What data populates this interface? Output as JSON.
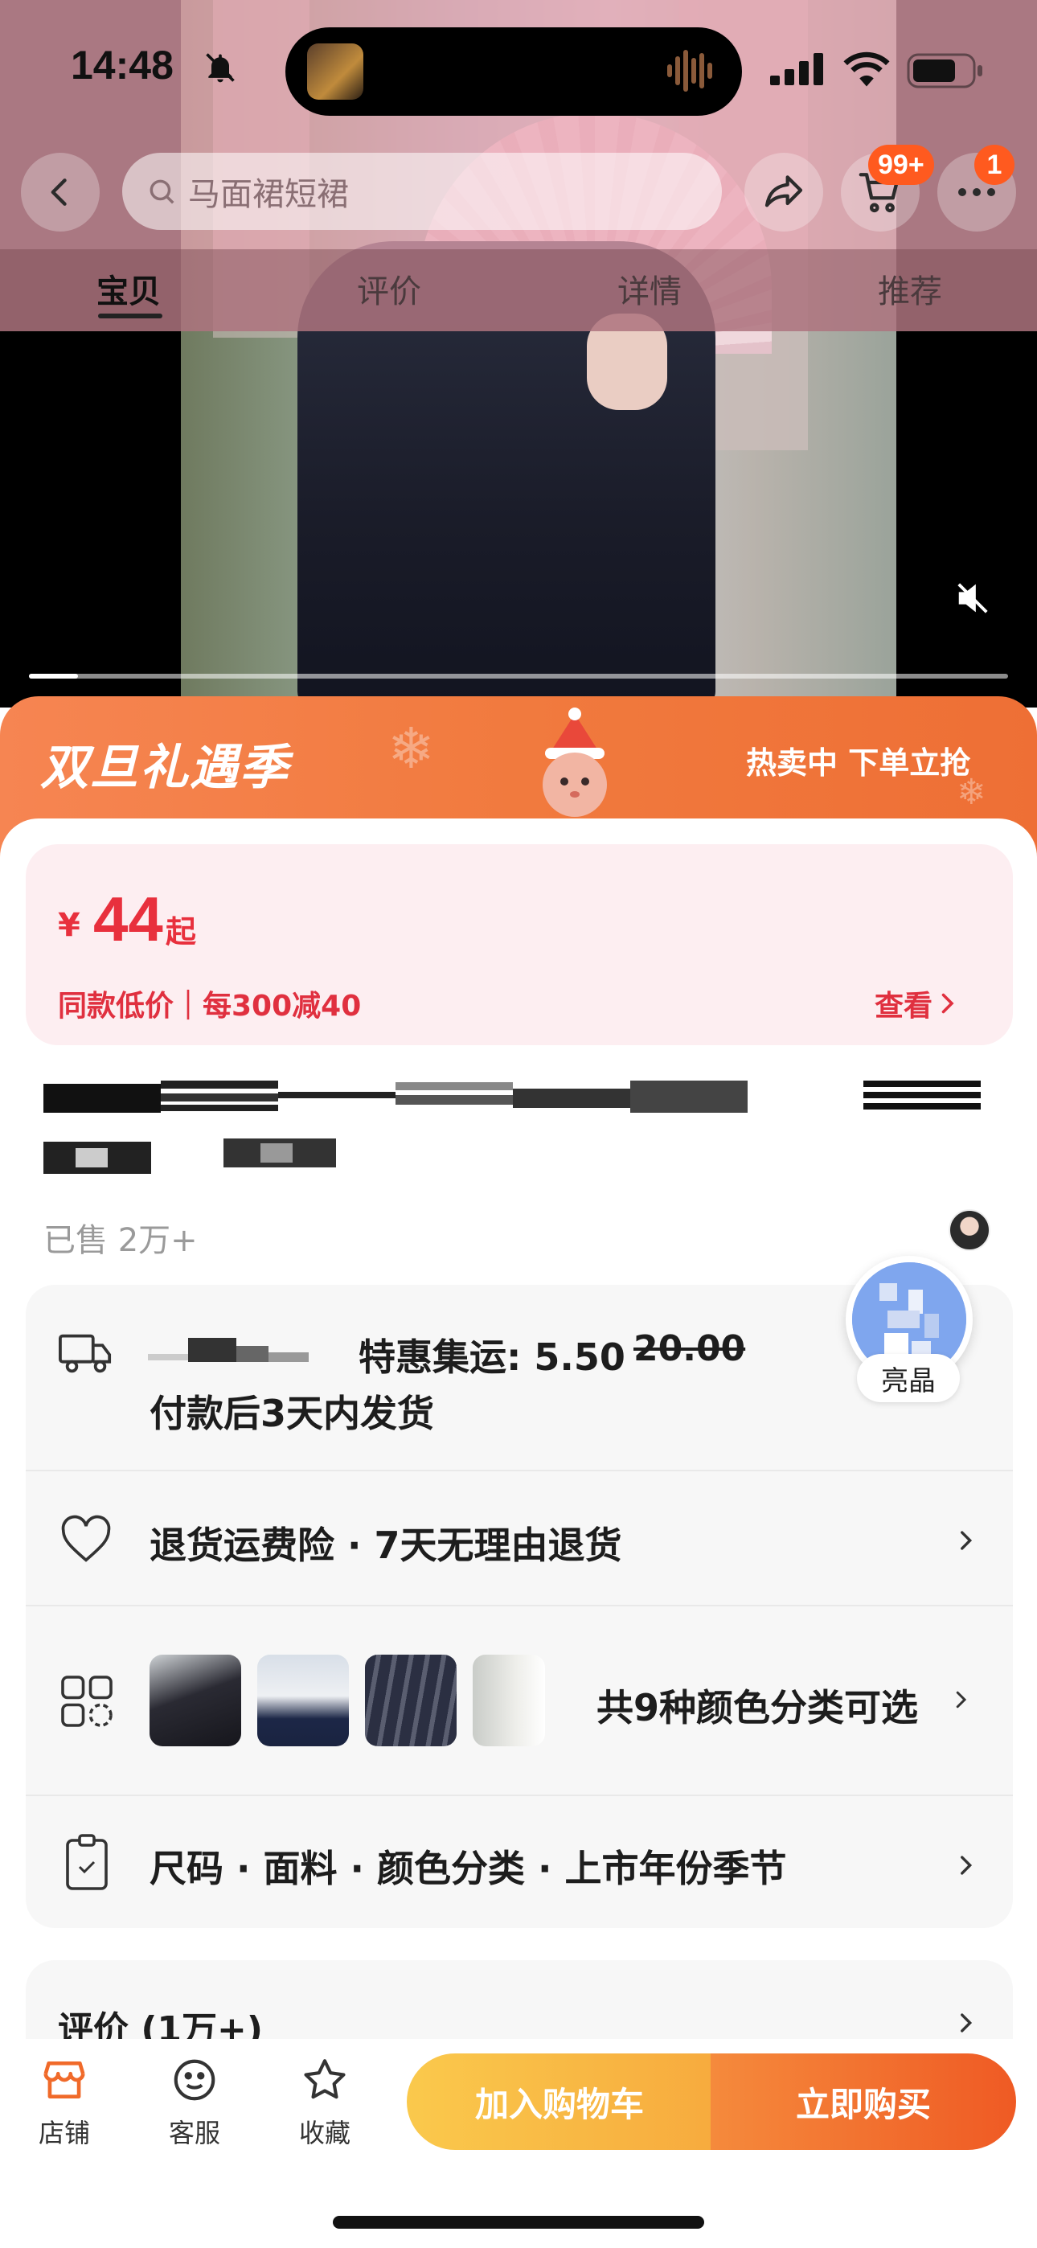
{
  "status_bar": {
    "time": "14:48"
  },
  "search": {
    "placeholder": "马面裙短裙"
  },
  "header": {
    "cart_badge": "99+",
    "more_badge": "1"
  },
  "tabs": [
    {
      "label": "宝贝",
      "active": true
    },
    {
      "label": "评价",
      "active": false
    },
    {
      "label": "详情",
      "active": false
    },
    {
      "label": "推荐",
      "active": false
    }
  ],
  "video": {
    "progress": 0.05,
    "muted": true
  },
  "promo": {
    "title": "双旦礼遇季",
    "right": "热卖中 下单立抢"
  },
  "price": {
    "symbol": "¥",
    "value": "44",
    "suffix": "起",
    "note": "同款低价｜每300减40",
    "link": "查看"
  },
  "sales": {
    "sold": "已售 2万+"
  },
  "shipping": {
    "label": "特惠集运: 5.50",
    "old_price": "20.00",
    "delivery": "付款后3天内发货"
  },
  "guarantee": {
    "text": "退货运费险 · 7天无理由退货"
  },
  "variants": {
    "text": "共9种颜色分类可选"
  },
  "specs": {
    "text": "尺码 · 面料 · 颜色分类 · 上市年份季节"
  },
  "reviews": {
    "title": "评价 (1万+)"
  },
  "floating": {
    "name": "亮晶"
  },
  "bottom_bar": {
    "store": "店铺",
    "service": "客服",
    "favorite": "收藏",
    "add_to_cart": "加入购物车",
    "buy_now": "立即购买"
  },
  "colors": {
    "accent": "#ee6f35",
    "price_red": "#e8303d",
    "price_card_bg": "#fdeef1",
    "cart_button": "#f7ab3e"
  },
  "icons": [
    "bell-slash-icon",
    "signal-icon",
    "wifi-icon",
    "battery-icon",
    "back-icon",
    "search-icon",
    "share-icon",
    "cart-icon",
    "more-icon",
    "mute-icon",
    "truck-icon",
    "heart-icon",
    "grid-icon",
    "clipboard-icon",
    "chevron-right-icon",
    "store-icon",
    "service-icon",
    "star-icon"
  ]
}
